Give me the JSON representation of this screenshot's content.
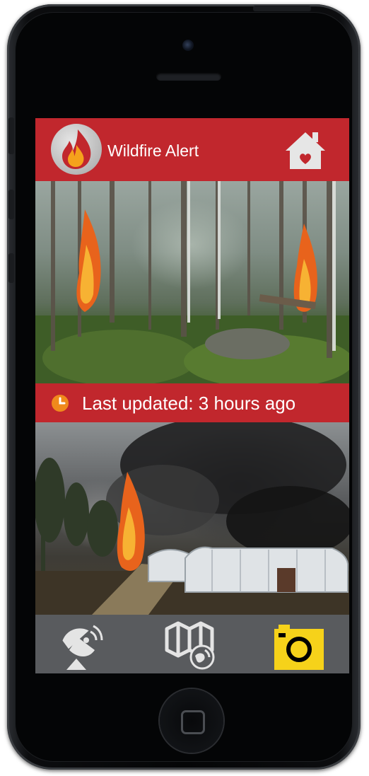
{
  "app": {
    "title": "Wildfire Alert"
  },
  "status": {
    "last_updated": "Last updated: 3 hours ago"
  },
  "icons": {
    "logo": "flame-logo-icon",
    "home": "home-heart-icon",
    "clock": "clock-icon",
    "nav": [
      "satellite-dish-icon",
      "map-globe-icon",
      "camera-icon"
    ]
  },
  "images": {
    "top": "forest-fire-photo",
    "bottom": "greenhouse-fire-photo"
  },
  "colors": {
    "accent": "#c1272d",
    "nav_bg": "#595b5e",
    "camera_active": "#f6d21a",
    "icon_light": "#e4e4e4",
    "clock_orange": "#f08a1c"
  },
  "navigation": {
    "active_tab": "camera"
  }
}
